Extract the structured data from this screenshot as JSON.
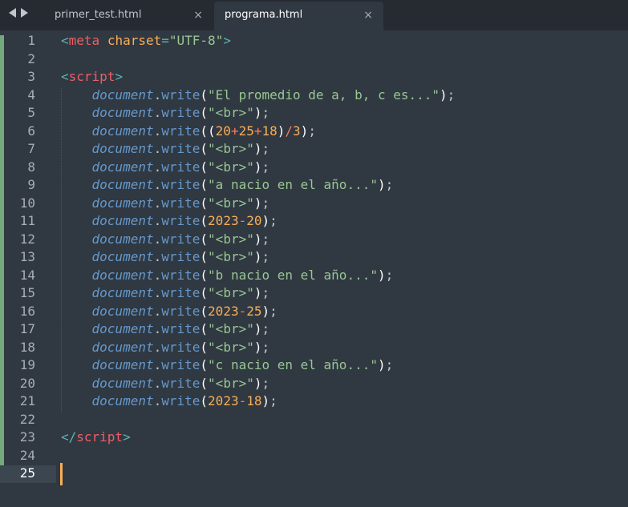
{
  "tabs": [
    {
      "label": "primer_test.html",
      "active": false,
      "close": "×"
    },
    {
      "label": "programa.html",
      "active": true,
      "close": "×"
    }
  ],
  "editor": {
    "line_numbers": [
      "1",
      "2",
      "3",
      "4",
      "5",
      "6",
      "7",
      "8",
      "9",
      "10",
      "11",
      "12",
      "13",
      "14",
      "15",
      "16",
      "17",
      "18",
      "19",
      "20",
      "21",
      "22",
      "23",
      "24",
      "25"
    ],
    "active_line": "25",
    "lines": [
      [
        [
          "c-punc",
          "<"
        ],
        [
          "c-tag",
          "meta"
        ],
        [
          "c-plain",
          " "
        ],
        [
          "c-attr",
          "charset"
        ],
        [
          "c-punc",
          "="
        ],
        [
          "c-str",
          "\"UTF-8\""
        ],
        [
          "c-punc",
          ">"
        ]
      ],
      [],
      [
        [
          "c-punc",
          "<"
        ],
        [
          "c-tag",
          "script"
        ],
        [
          "c-punc",
          ">"
        ]
      ],
      [
        [
          "c-plain",
          "    "
        ],
        [
          "c-obj",
          "document"
        ],
        [
          "c-dot",
          "."
        ],
        [
          "c-fn",
          "write"
        ],
        [
          "c-paren",
          "("
        ],
        [
          "c-str",
          "\"El promedio de a, b, c es...\""
        ],
        [
          "c-paren",
          ")"
        ],
        [
          "c-dot",
          ";"
        ]
      ],
      [
        [
          "c-plain",
          "    "
        ],
        [
          "c-obj",
          "document"
        ],
        [
          "c-dot",
          "."
        ],
        [
          "c-fn",
          "write"
        ],
        [
          "c-paren",
          "("
        ],
        [
          "c-str",
          "\"<br>\""
        ],
        [
          "c-paren",
          ")"
        ],
        [
          "c-dot",
          ";"
        ]
      ],
      [
        [
          "c-plain",
          "    "
        ],
        [
          "c-obj",
          "document"
        ],
        [
          "c-dot",
          "."
        ],
        [
          "c-fn",
          "write"
        ],
        [
          "c-paren",
          "(("
        ],
        [
          "c-num",
          "20"
        ],
        [
          "c-op",
          "+"
        ],
        [
          "c-num",
          "25"
        ],
        [
          "c-op",
          "+"
        ],
        [
          "c-num",
          "18"
        ],
        [
          "c-paren",
          ")"
        ],
        [
          "c-op",
          "/"
        ],
        [
          "c-num",
          "3"
        ],
        [
          "c-paren",
          ")"
        ],
        [
          "c-dot",
          ";"
        ]
      ],
      [
        [
          "c-plain",
          "    "
        ],
        [
          "c-obj",
          "document"
        ],
        [
          "c-dot",
          "."
        ],
        [
          "c-fn",
          "write"
        ],
        [
          "c-paren",
          "("
        ],
        [
          "c-str",
          "\"<br>\""
        ],
        [
          "c-paren",
          ")"
        ],
        [
          "c-dot",
          ";"
        ]
      ],
      [
        [
          "c-plain",
          "    "
        ],
        [
          "c-obj",
          "document"
        ],
        [
          "c-dot",
          "."
        ],
        [
          "c-fn",
          "write"
        ],
        [
          "c-paren",
          "("
        ],
        [
          "c-str",
          "\"<br>\""
        ],
        [
          "c-paren",
          ")"
        ],
        [
          "c-dot",
          ";"
        ]
      ],
      [
        [
          "c-plain",
          "    "
        ],
        [
          "c-obj",
          "document"
        ],
        [
          "c-dot",
          "."
        ],
        [
          "c-fn",
          "write"
        ],
        [
          "c-paren",
          "("
        ],
        [
          "c-str",
          "\"a nacio en el año...\""
        ],
        [
          "c-paren",
          ")"
        ],
        [
          "c-dot",
          ";"
        ]
      ],
      [
        [
          "c-plain",
          "    "
        ],
        [
          "c-obj",
          "document"
        ],
        [
          "c-dot",
          "."
        ],
        [
          "c-fn",
          "write"
        ],
        [
          "c-paren",
          "("
        ],
        [
          "c-str",
          "\"<br>\""
        ],
        [
          "c-paren",
          ")"
        ],
        [
          "c-dot",
          ";"
        ]
      ],
      [
        [
          "c-plain",
          "    "
        ],
        [
          "c-obj",
          "document"
        ],
        [
          "c-dot",
          "."
        ],
        [
          "c-fn",
          "write"
        ],
        [
          "c-paren",
          "("
        ],
        [
          "c-num",
          "2023"
        ],
        [
          "c-op",
          "-"
        ],
        [
          "c-num",
          "20"
        ],
        [
          "c-paren",
          ")"
        ],
        [
          "c-dot",
          ";"
        ]
      ],
      [
        [
          "c-plain",
          "    "
        ],
        [
          "c-obj",
          "document"
        ],
        [
          "c-dot",
          "."
        ],
        [
          "c-fn",
          "write"
        ],
        [
          "c-paren",
          "("
        ],
        [
          "c-str",
          "\"<br>\""
        ],
        [
          "c-paren",
          ")"
        ],
        [
          "c-dot",
          ";"
        ]
      ],
      [
        [
          "c-plain",
          "    "
        ],
        [
          "c-obj",
          "document"
        ],
        [
          "c-dot",
          "."
        ],
        [
          "c-fn",
          "write"
        ],
        [
          "c-paren",
          "("
        ],
        [
          "c-str",
          "\"<br>\""
        ],
        [
          "c-paren",
          ")"
        ],
        [
          "c-dot",
          ";"
        ]
      ],
      [
        [
          "c-plain",
          "    "
        ],
        [
          "c-obj",
          "document"
        ],
        [
          "c-dot",
          "."
        ],
        [
          "c-fn",
          "write"
        ],
        [
          "c-paren",
          "("
        ],
        [
          "c-str",
          "\"b nacio en el año...\""
        ],
        [
          "c-paren",
          ")"
        ],
        [
          "c-dot",
          ";"
        ]
      ],
      [
        [
          "c-plain",
          "    "
        ],
        [
          "c-obj",
          "document"
        ],
        [
          "c-dot",
          "."
        ],
        [
          "c-fn",
          "write"
        ],
        [
          "c-paren",
          "("
        ],
        [
          "c-str",
          "\"<br>\""
        ],
        [
          "c-paren",
          ")"
        ],
        [
          "c-dot",
          ";"
        ]
      ],
      [
        [
          "c-plain",
          "    "
        ],
        [
          "c-obj",
          "document"
        ],
        [
          "c-dot",
          "."
        ],
        [
          "c-fn",
          "write"
        ],
        [
          "c-paren",
          "("
        ],
        [
          "c-num",
          "2023"
        ],
        [
          "c-op",
          "-"
        ],
        [
          "c-num",
          "25"
        ],
        [
          "c-paren",
          ")"
        ],
        [
          "c-dot",
          ";"
        ]
      ],
      [
        [
          "c-plain",
          "    "
        ],
        [
          "c-obj",
          "document"
        ],
        [
          "c-dot",
          "."
        ],
        [
          "c-fn",
          "write"
        ],
        [
          "c-paren",
          "("
        ],
        [
          "c-str",
          "\"<br>\""
        ],
        [
          "c-paren",
          ")"
        ],
        [
          "c-dot",
          ";"
        ]
      ],
      [
        [
          "c-plain",
          "    "
        ],
        [
          "c-obj",
          "document"
        ],
        [
          "c-dot",
          "."
        ],
        [
          "c-fn",
          "write"
        ],
        [
          "c-paren",
          "("
        ],
        [
          "c-str",
          "\"<br>\""
        ],
        [
          "c-paren",
          ")"
        ],
        [
          "c-dot",
          ";"
        ]
      ],
      [
        [
          "c-plain",
          "    "
        ],
        [
          "c-obj",
          "document"
        ],
        [
          "c-dot",
          "."
        ],
        [
          "c-fn",
          "write"
        ],
        [
          "c-paren",
          "("
        ],
        [
          "c-str",
          "\"c nacio en el año...\""
        ],
        [
          "c-paren",
          ")"
        ],
        [
          "c-dot",
          ";"
        ]
      ],
      [
        [
          "c-plain",
          "    "
        ],
        [
          "c-obj",
          "document"
        ],
        [
          "c-dot",
          "."
        ],
        [
          "c-fn",
          "write"
        ],
        [
          "c-paren",
          "("
        ],
        [
          "c-str",
          "\"<br>\""
        ],
        [
          "c-paren",
          ")"
        ],
        [
          "c-dot",
          ";"
        ]
      ],
      [
        [
          "c-plain",
          "    "
        ],
        [
          "c-obj",
          "document"
        ],
        [
          "c-dot",
          "."
        ],
        [
          "c-fn",
          "write"
        ],
        [
          "c-paren",
          "("
        ],
        [
          "c-num",
          "2023"
        ],
        [
          "c-op",
          "-"
        ],
        [
          "c-num",
          "18"
        ],
        [
          "c-paren",
          ")"
        ],
        [
          "c-dot",
          ";"
        ]
      ],
      [],
      [
        [
          "c-punc",
          "</"
        ],
        [
          "c-tag",
          "script"
        ],
        [
          "c-punc",
          ">"
        ]
      ],
      [],
      []
    ]
  },
  "colors": {
    "background": "#303841",
    "tabbar": "#252b31",
    "git_added": "#75a87a",
    "caret": "#f9ae58"
  }
}
